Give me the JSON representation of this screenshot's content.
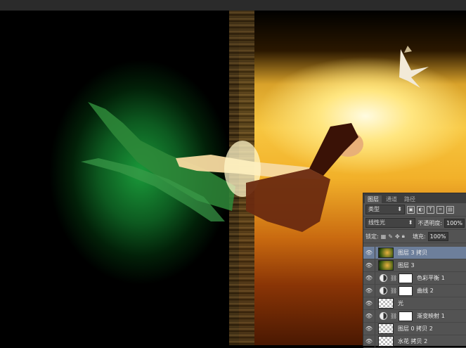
{
  "layers_panel": {
    "tabs": [
      "图层",
      "通道",
      "路径"
    ],
    "filter_kind": "类型",
    "blend_mode": "线性光",
    "opacity_label": "不透明度:",
    "opacity_value": "100%",
    "lock_label": "锁定:",
    "fill_label": "填充:",
    "fill_value": "100%",
    "layers": [
      {
        "name": "图层 3 拷贝",
        "type": "image",
        "selected": true
      },
      {
        "name": "图层 3",
        "type": "image",
        "selected": false
      },
      {
        "name": "色彩平衡 1",
        "type": "adjustment",
        "selected": false
      },
      {
        "name": "曲线 2",
        "type": "adjustment",
        "selected": false
      },
      {
        "name": "光",
        "type": "pixel",
        "selected": false
      },
      {
        "name": "渐变映射 1",
        "type": "adjustment",
        "selected": false
      },
      {
        "name": "图层 0 拷贝 2",
        "type": "pixel",
        "selected": false
      },
      {
        "name": "水花 拷贝 2",
        "type": "pixel",
        "selected": false
      }
    ]
  },
  "colors": {
    "panel_bg": "#535353",
    "selected_layer": "#6d7f9b",
    "green_glow": "#1a9a3a",
    "gold_glow": "#f7c640"
  }
}
